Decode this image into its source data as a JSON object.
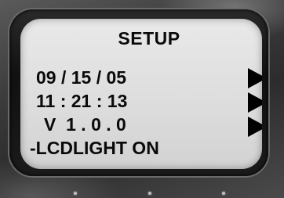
{
  "screen": {
    "title": "SETUP",
    "rows": [
      {
        "text": "09 / 15 / 05",
        "arrow_icon": "right-arrow-icon"
      },
      {
        "text": "11 : 21 : 13",
        "arrow_icon": "right-arrow-icon"
      },
      {
        "text": "V  1 . 0 . 0",
        "arrow_icon": "right-arrow-icon"
      },
      {
        "text": "-LCDLIGHT ON"
      }
    ]
  },
  "colors": {
    "screen_background": "#dcdcdc",
    "text": "#0a0a0a",
    "bezel": "#111111",
    "housing": "#3a3a3a"
  }
}
